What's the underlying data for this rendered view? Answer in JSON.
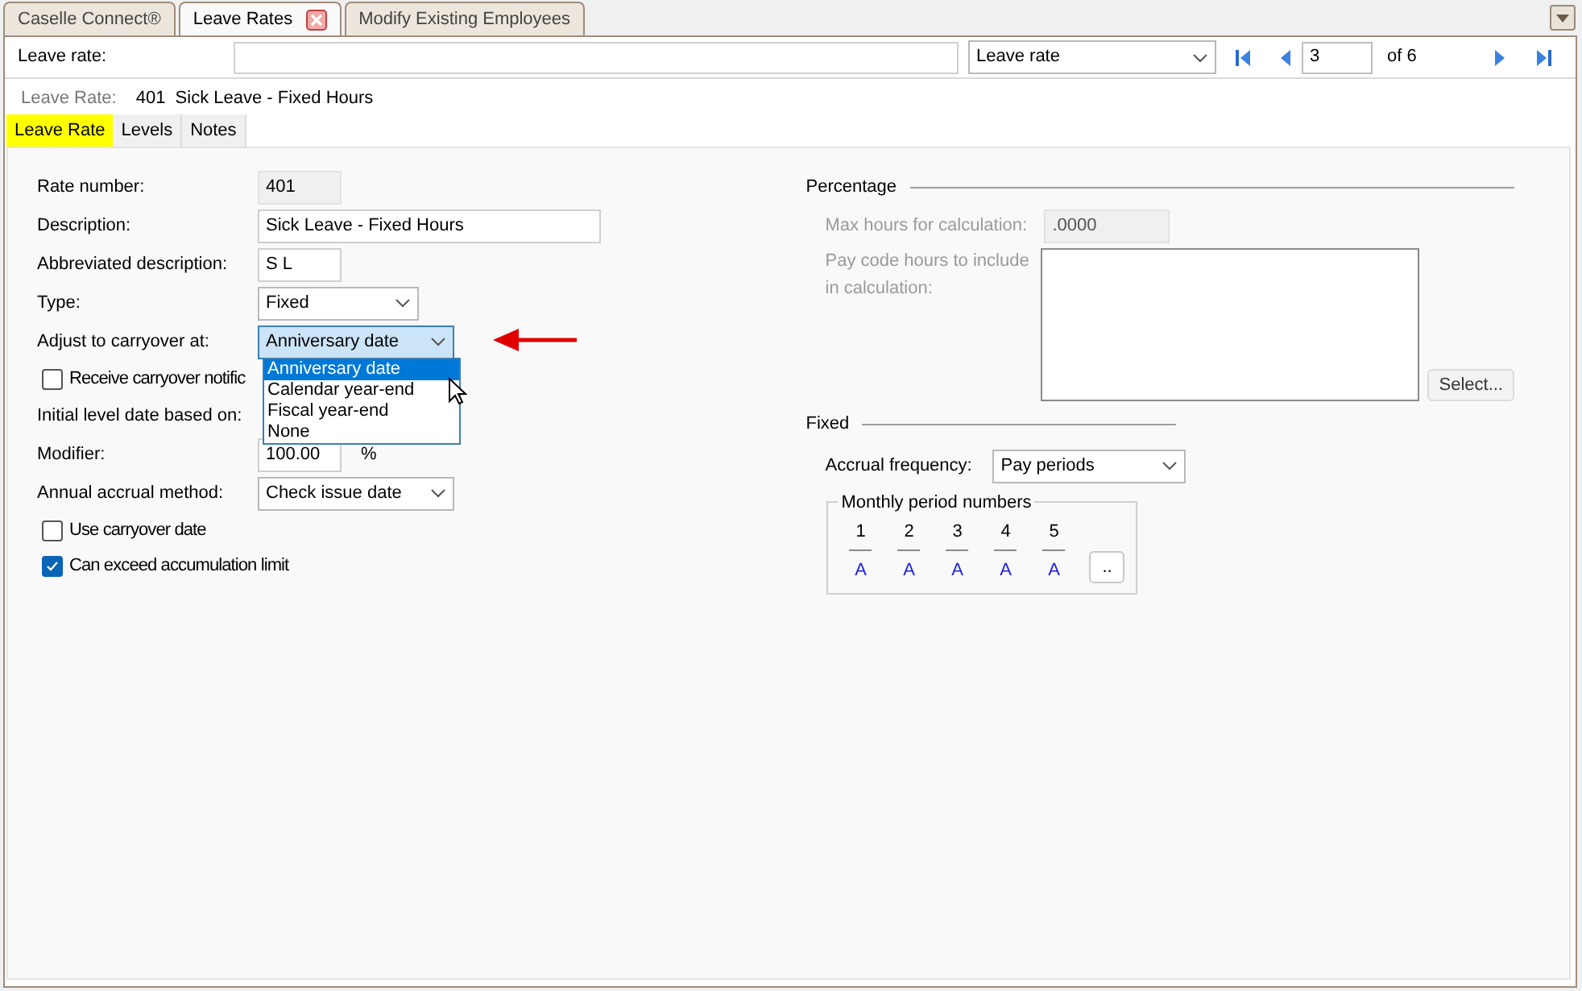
{
  "top_tabs": [
    {
      "label": "Caselle Connect®",
      "selected": false,
      "closable": false
    },
    {
      "label": "Leave Rates",
      "selected": true,
      "closable": true
    },
    {
      "label": "Modify Existing Employees",
      "selected": false,
      "closable": false
    }
  ],
  "toolbar": {
    "label": "Leave rate:",
    "lookup": "Leave rate",
    "record": "3",
    "record_count": "of 6"
  },
  "header": {
    "label": "Leave Rate:",
    "value": "401  Sick Leave - Fixed Hours"
  },
  "sub_tabs": [
    {
      "label": "Leave Rate",
      "selected": true
    },
    {
      "label": "Levels",
      "selected": false
    },
    {
      "label": "Notes",
      "selected": false
    }
  ],
  "form": [
    {
      "kind": "readonly",
      "label": "Rate number:",
      "value": "401"
    },
    {
      "kind": "text",
      "label": "Description:",
      "value": "Sick Leave - Fixed Hours",
      "wide": true
    },
    {
      "kind": "text",
      "label": "Abbreviated description:",
      "value": "S L",
      "wide": false
    },
    {
      "kind": "select",
      "label": "Type:",
      "value": "Fixed"
    },
    {
      "kind": "select",
      "label": "Adjust to carryover at:",
      "value": "Anniversary date",
      "open": true
    },
    {
      "kind": "checkbox",
      "label": "Receive carryover notific",
      "checked": false
    },
    {
      "kind": "label",
      "label": "Initial level date based on:"
    },
    {
      "kind": "percent",
      "label": "Modifier:",
      "value": "100.00",
      "suffix": "%"
    },
    {
      "kind": "select",
      "label": "Annual accrual method:",
      "value": "Check issue date"
    },
    {
      "kind": "checkbox",
      "label": "Use carryover date",
      "checked": false
    },
    {
      "kind": "checkbox",
      "label": "Can exceed accumulation limit",
      "checked": true
    }
  ],
  "dropdown_options": [
    {
      "label": "Anniversary date",
      "selected": true
    },
    {
      "label": "Calendar year-end",
      "selected": false
    },
    {
      "label": "Fiscal year-end",
      "selected": false
    },
    {
      "label": "None",
      "selected": false
    }
  ],
  "percentage": {
    "title": "Percentage",
    "max_hours": {
      "label": "Max hours for calculation:",
      "value": ".0000",
      "disabled": true
    },
    "pay_codes": {
      "label": "Pay code hours to include in calculation:",
      "disabled": true
    },
    "select_button": "Select..."
  },
  "fixed": {
    "title": "Fixed",
    "accrual_frequency": {
      "label": "Accrual frequency:",
      "value": "Pay periods"
    },
    "group_title": "Monthly period numbers",
    "periods": [
      {
        "number": "1",
        "value": "A"
      },
      {
        "number": "2",
        "value": "A"
      },
      {
        "number": "3",
        "value": "A"
      },
      {
        "number": "4",
        "value": "A"
      },
      {
        "number": "5",
        "value": "A"
      }
    ],
    "more_button": ".."
  }
}
